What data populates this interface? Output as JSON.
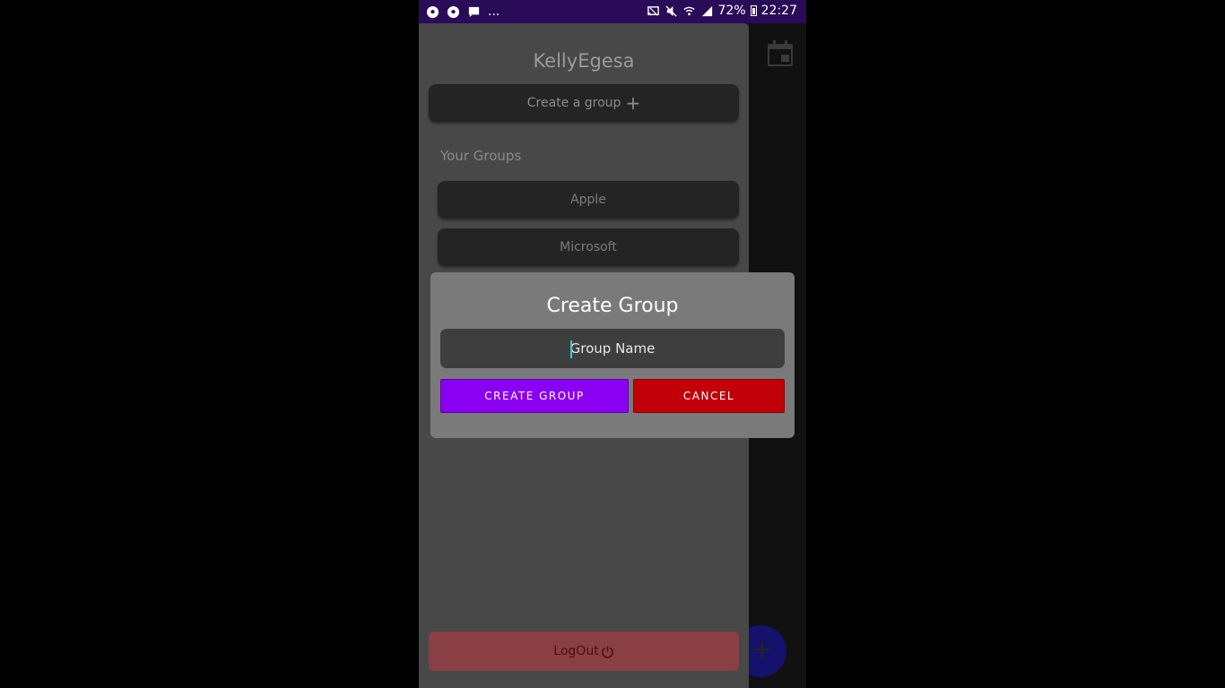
{
  "status_bar": {
    "left_icons": [
      "soccer-ball-icon",
      "soccer-ball-icon",
      "chat-bubble-icon"
    ],
    "overflow": "...",
    "right_icons": [
      "cast-icon",
      "mute-icon",
      "wifi-icon",
      "signal-icon",
      "battery-icon"
    ],
    "battery_percent": "72%",
    "time": "22:27"
  },
  "drawer": {
    "user_name": "KellyEgesa",
    "create_group_label": "Create a group",
    "create_group_icon": "+",
    "section_title": "Your Groups",
    "groups": [
      {
        "name": "Apple"
      },
      {
        "name": "Microsoft"
      }
    ],
    "logout_label": "LogOut",
    "logout_icon": "power-icon"
  },
  "background_screen": {
    "calendar_icon": "calendar-icon",
    "fab_icon": "+"
  },
  "modal": {
    "title": "Create Group",
    "input_placeholder": "Group Name",
    "input_value": "",
    "create_button": "CREATE GROUP",
    "cancel_button": "CANCEL"
  },
  "colors": {
    "status_bar": "#2a0b57",
    "create_button": "#8a00f0",
    "cancel_button": "#c10008",
    "logout_button": "#8a3f45",
    "caret": "#29d3e0"
  }
}
